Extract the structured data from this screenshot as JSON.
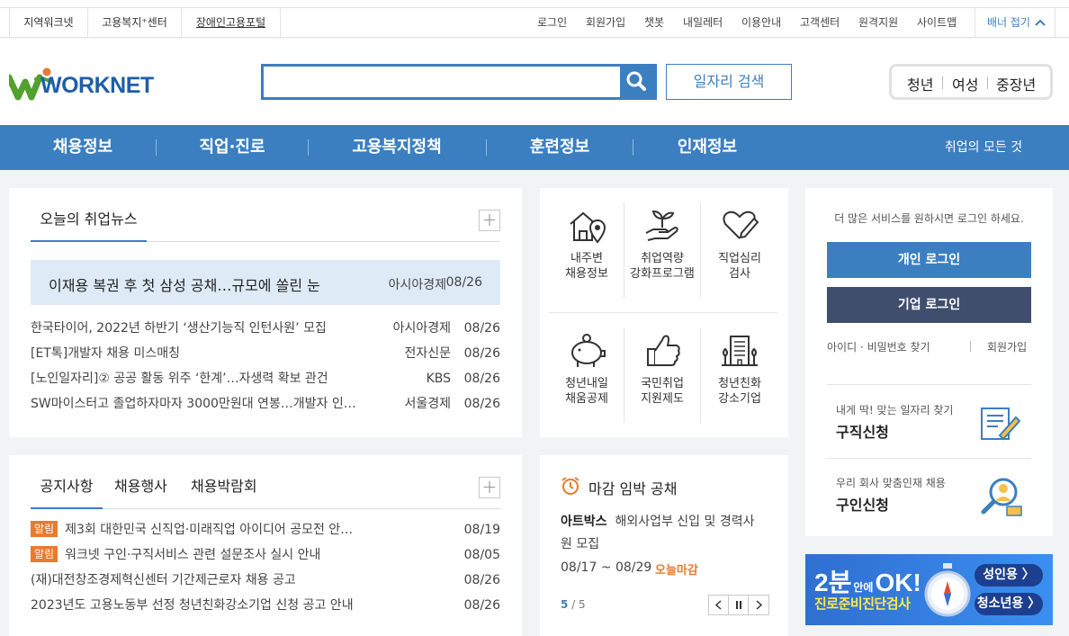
{
  "topbar": {
    "left_links": [
      "지역워크넷",
      "고용복지⁺센터",
      "장애인고용포털"
    ],
    "right_links": [
      "로그인",
      "회원가입",
      "챗봇",
      "내일레터",
      "이용안내",
      "고객센터",
      "원격지원",
      "사이트맵"
    ],
    "fold_label": "배너 접기"
  },
  "header": {
    "logo_text": "WORKNET",
    "search": {
      "value": "",
      "placeholder": ""
    },
    "job_search_button": "일자리 검색",
    "audience": [
      "청년",
      "여성",
      "중장년"
    ]
  },
  "nav": {
    "items": [
      "채용정보",
      "직업·진로",
      "고용복지정책",
      "훈련정보",
      "인재정보"
    ],
    "all_label": "취업의 모든 것"
  },
  "news": {
    "tab": "오늘의 취업뉴스",
    "highlight": {
      "title": "이재용 복권 후 첫 삼성 공채…규모에 쏠린 눈",
      "source": "아시아경제",
      "date": "08/26"
    },
    "items": [
      {
        "title": "한국타이어, 2022년 하반기 ‘생산기능직 인턴사원’ 모집",
        "source": "아시아경제",
        "date": "08/26"
      },
      {
        "title": "[ET톡]개발자 채용 미스매칭",
        "source": "전자신문",
        "date": "08/26"
      },
      {
        "title": "[노인일자리]② 공공 활동 위주 ‘한계’…자생력 확보 관건",
        "source": "KBS",
        "date": "08/26"
      },
      {
        "title": "SW마이스터고 졸업하자마자 3000만원대 연봉…개발자 인…",
        "source": "서울경제",
        "date": "08/26"
      }
    ]
  },
  "services": [
    {
      "icon": "house-location-icon",
      "line1": "내주변",
      "line2": "채용정보"
    },
    {
      "icon": "sprout-hand-icon",
      "line1": "취업역량",
      "line2": "강화프로그램"
    },
    {
      "icon": "heart-pen-icon",
      "line1": "직업심리",
      "line2": "검사"
    },
    {
      "icon": "piggy-bank-icon",
      "line1": "청년내일",
      "line2": "채움공제"
    },
    {
      "icon": "thumbs-up-icon",
      "line1": "국민취업",
      "line2": "지원제도"
    },
    {
      "icon": "building-icon",
      "line1": "청년친화",
      "line2": "강소기업"
    }
  ],
  "login": {
    "prompt": "더 많은 서비스를 원하시면 로그인 하세요.",
    "personal": "개인 로그인",
    "company": "기업 로그인",
    "find": "아이디 · 비밀번호 찾기",
    "join": "회원가입",
    "job_seek_sub": "내게 딱! 맞는 일자리 찾기",
    "job_seek_title": "구직신청",
    "recruit_sub": "우리 회사 맞춤인재 채용",
    "recruit_title": "구인신청"
  },
  "notice": {
    "tabs": [
      "공지사항",
      "채용행사",
      "채용박람회"
    ],
    "items": [
      {
        "tag": "알림",
        "title": "제3회 대한민국 신직업·미래직업 아이디어 공모전 안…",
        "date": "08/19"
      },
      {
        "tag": "알림",
        "title": "워크넷 구인·구직서비스 관련 설문조사 실시 안내",
        "date": "08/05"
      },
      {
        "tag": "",
        "title": "(재)대전창조경제혁신센터 기간제근로자 채용 공고",
        "date": "08/26"
      },
      {
        "tag": "",
        "title": "2023년도 고용노동부 선정 청년친화강소기업 신청 공고 안내",
        "date": "08/26"
      }
    ]
  },
  "deadline": {
    "title": "마감 임박 공채",
    "company": "아트박스",
    "desc_line1": "해외사업부 신입 및 경력사",
    "desc_line2": "원 모집",
    "period": "08/17 ~ 08/29",
    "status": "오늘마감",
    "page_current": "5",
    "page_total": "/ 5"
  },
  "banner": {
    "big": "2분",
    "mid": "안에",
    "ok": "OK!",
    "sub": "진로준비진단검사",
    "btn_adult": "성인용 〉",
    "btn_youth": "청소년용 〉"
  },
  "colors": {
    "primary": "#3c7fc1",
    "navy": "#3f4e6c",
    "orange": "#e77b2f",
    "logo_green": "#52a02e",
    "logo_blue": "#1f5ea8"
  }
}
